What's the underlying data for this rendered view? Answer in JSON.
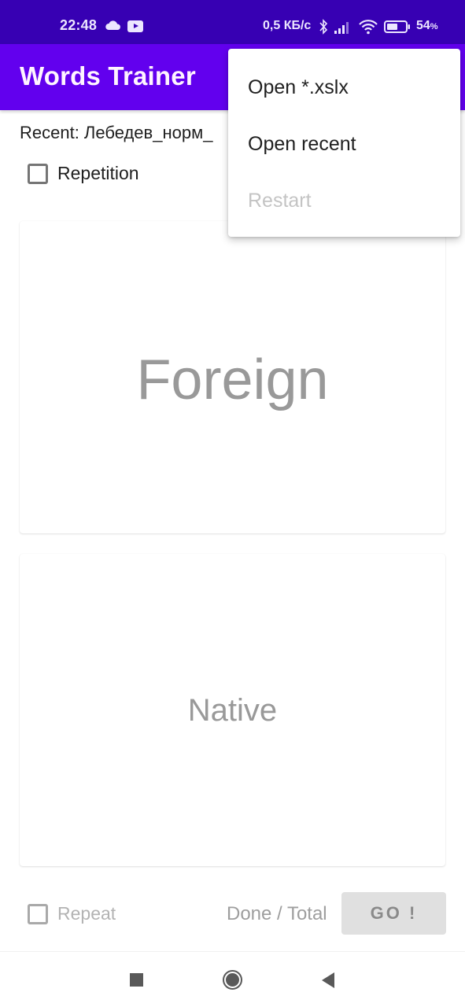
{
  "status_bar": {
    "time": "22:48",
    "netspeed": "0,5 КБ/с",
    "battery_percent": "54",
    "battery_unit": "%",
    "battery_level": 0.54,
    "icons": [
      "cloud-icon",
      "youtube-icon",
      "bluetooth-icon",
      "signal-icon",
      "wifi-icon",
      "battery-icon"
    ]
  },
  "app_bar": {
    "title": "Words Trainer"
  },
  "main": {
    "recent_label": "Recent: Лебедев_норм_",
    "repetition_checkbox": {
      "label": "Repetition",
      "checked": false
    },
    "foreign_card": {
      "word": "Foreign"
    },
    "native_card": {
      "word": "Native"
    },
    "repeat_checkbox": {
      "label": "Repeat",
      "checked": false,
      "enabled": false
    },
    "progress_label": "Done / Total",
    "go_button": {
      "label": "GO !",
      "enabled": false
    }
  },
  "popup_menu": {
    "items": [
      {
        "label": "Open *.xslx",
        "enabled": true
      },
      {
        "label": "Open recent",
        "enabled": true
      },
      {
        "label": "Restart",
        "enabled": false
      }
    ]
  },
  "nav_bar": {
    "buttons": [
      "recents",
      "home",
      "back"
    ]
  },
  "colors": {
    "status_bar": "#3700B3",
    "primary": "#6200EE",
    "hint_text": "#999999",
    "disabled_button": "#E0E0E0"
  }
}
